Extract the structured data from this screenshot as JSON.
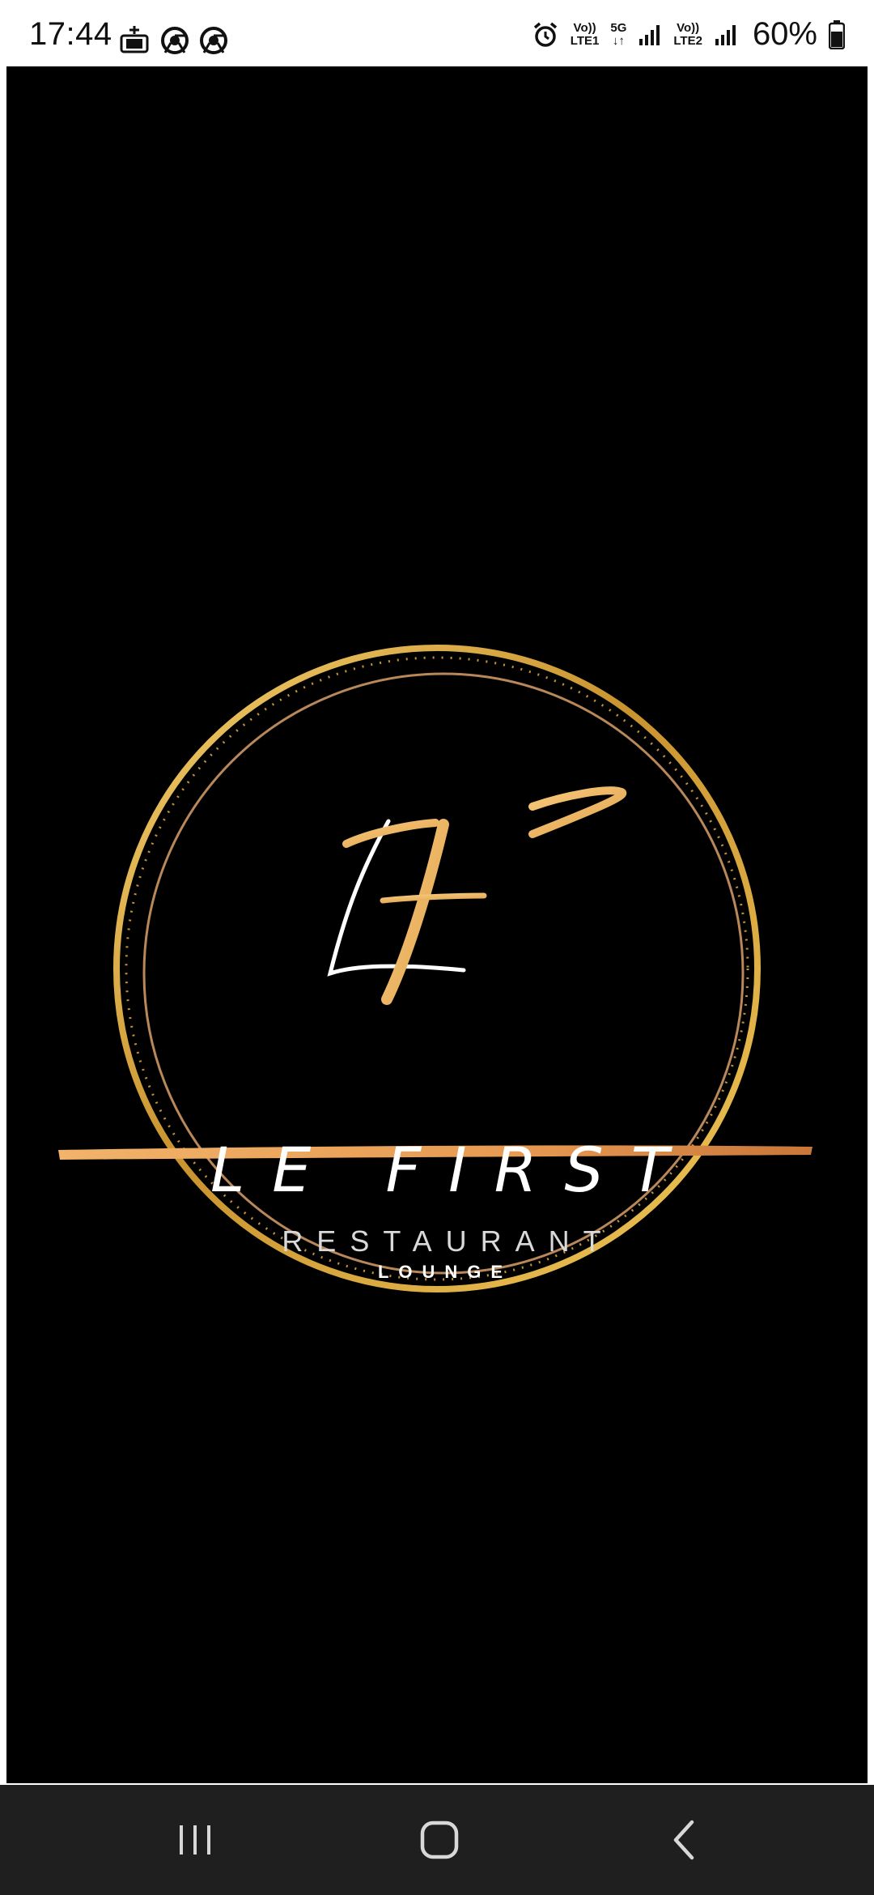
{
  "status_bar": {
    "time": "17:44",
    "sim1_top": "Vo))",
    "sim1_bottom": "LTE1",
    "net_type": "5G",
    "sim2_top": "Vo))",
    "sim2_bottom": "LTE2",
    "battery": "60%"
  },
  "logo": {
    "monogram": "LF",
    "title": "LE FIRST",
    "subtitle": "RESTAURANT",
    "subtitle2": "LOUNGE",
    "gold_color": "#d9a441",
    "bar_color": "#e8a55c"
  },
  "nav_bar": {
    "recents_icon": "recents-icon",
    "home_icon": "home-icon",
    "back_icon": "back-icon"
  }
}
